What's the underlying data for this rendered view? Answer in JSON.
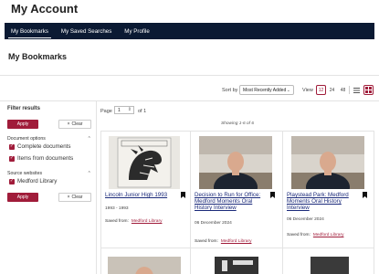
{
  "page": {
    "title": "My Account",
    "section_title": "My Bookmarks"
  },
  "nav": {
    "tabs": [
      {
        "label": "My Bookmarks",
        "active": true
      },
      {
        "label": "My Saved Searches",
        "active": false
      },
      {
        "label": "My Profile",
        "active": false
      }
    ]
  },
  "toolbar": {
    "sort_label": "Sort by",
    "sort_value": "Most Recently Added",
    "view_label": "View",
    "view_options": [
      "12",
      "24",
      "48"
    ],
    "view_selected": "12",
    "layout_modes": [
      "list-icon",
      "grid-icon"
    ],
    "layout_selected": "grid-icon"
  },
  "filters": {
    "title": "Filter results",
    "apply_label": "Apply",
    "clear_label": "Clear",
    "groups": [
      {
        "title": "Document options",
        "items": [
          "Complete documents",
          "Items from documents"
        ]
      },
      {
        "title": "Source websites",
        "items": [
          "Medford Library"
        ]
      }
    ]
  },
  "pagination": {
    "page_label": "Page",
    "page_value": "1",
    "of_label": "of 1"
  },
  "results": {
    "showing": "Showing 1-6 of 6",
    "items": [
      {
        "title": "Lincoln Junior High 1993",
        "date": "1993 - 1993",
        "saved_from_label": "Saved from:",
        "source": "Medford Library"
      },
      {
        "title": "Decision to Run for Office: Medford Moments Oral History Interview",
        "date": "06 December 2024",
        "saved_from_label": "Saved from:",
        "source": "Medford Library"
      },
      {
        "title": "Playstead Park: Medford Moments Oral History Interview",
        "date": "06 December 2024",
        "saved_from_label": "Saved from:",
        "source": "Medford Library"
      }
    ]
  },
  "colors": {
    "accent": "#a01c3a",
    "nav_bg": "#0b1a33",
    "link": "#1b2a7a"
  }
}
